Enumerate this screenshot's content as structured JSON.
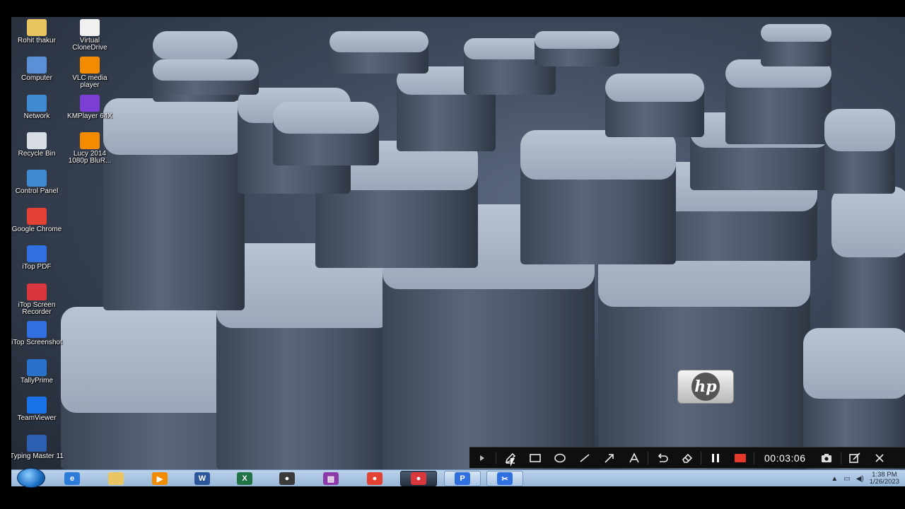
{
  "desktop": {
    "icons_col1": [
      {
        "label": "Rohit thakur",
        "icon": "folder-icon",
        "color": "#e8c560"
      },
      {
        "label": "Computer",
        "icon": "computer-icon",
        "color": "#5b8fd6"
      },
      {
        "label": "Network",
        "icon": "network-icon",
        "color": "#3f8ad1"
      },
      {
        "label": "Recycle Bin",
        "icon": "recycle-bin-icon",
        "color": "#d8dde3"
      },
      {
        "label": "Control Panel",
        "icon": "control-panel-icon",
        "color": "#3f8ad1"
      },
      {
        "label": "Google Chrome",
        "icon": "chrome-icon",
        "color": "#e34133"
      },
      {
        "label": "iTop PDF",
        "icon": "itop-pdf-icon",
        "color": "#2f6fe0"
      },
      {
        "label": "iTop Screen Recorder",
        "icon": "itop-recorder-icon",
        "color": "#d9363e"
      },
      {
        "label": "iTop Screenshot",
        "icon": "itop-screenshot-icon",
        "color": "#2f6fe0"
      },
      {
        "label": "TallyPrime",
        "icon": "tallyprime-icon",
        "color": "#2a72c9"
      },
      {
        "label": "TeamViewer",
        "icon": "teamviewer-icon",
        "color": "#1a73e8"
      },
      {
        "label": "Typing Master 11",
        "icon": "typing-master-icon",
        "color": "#2d5fb0"
      }
    ],
    "icons_col2": [
      {
        "label": "Virtual CloneDrive",
        "icon": "sheep-icon",
        "color": "#f0f0f0"
      },
      {
        "label": "VLC media player",
        "icon": "vlc-icon",
        "color": "#f28b00"
      },
      {
        "label": "KMPlayer 64X",
        "icon": "kmplayer-icon",
        "color": "#7b3fd6"
      },
      {
        "label": "Lucy 2014 1080p BluR...",
        "icon": "vlc-file-icon",
        "color": "#f28b00"
      }
    ],
    "logo_text": "hp"
  },
  "recorder_toolbar": {
    "timer": "00:03:06",
    "tools": [
      "expand-icon",
      "pen-icon",
      "rectangle-icon",
      "ellipse-icon",
      "line-icon",
      "arrow-icon",
      "text-icon",
      "undo-icon",
      "eraser-icon",
      "pause-icon",
      "stop-icon",
      "camera-icon",
      "edit-icon",
      "close-icon"
    ],
    "stop_color": "#e53a2a"
  },
  "taskbar": {
    "apps": [
      {
        "name": "internet-explorer",
        "glyph": "e",
        "color": "#2d7bd8"
      },
      {
        "name": "file-explorer",
        "glyph": "",
        "color": "#e8c560"
      },
      {
        "name": "media-player",
        "glyph": "▶",
        "color": "#f28b00"
      },
      {
        "name": "word",
        "glyph": "W",
        "color": "#2b579a"
      },
      {
        "name": "excel",
        "glyph": "X",
        "color": "#217346"
      },
      {
        "name": "media-center",
        "glyph": "●",
        "color": "#3a3a3a"
      },
      {
        "name": "winrar",
        "glyph": "▤",
        "color": "#8b3aa8"
      },
      {
        "name": "chrome",
        "glyph": "●",
        "color": "#e34133"
      },
      {
        "name": "itop-recorder",
        "glyph": "●",
        "color": "#d9363e"
      },
      {
        "name": "itop-pdf",
        "glyph": "P",
        "color": "#2f6fe0"
      },
      {
        "name": "itop-screenshot",
        "glyph": "✂",
        "color": "#2f6fe0"
      }
    ],
    "clock_time": "1:38 PM",
    "clock_date": "1/26/2023"
  }
}
